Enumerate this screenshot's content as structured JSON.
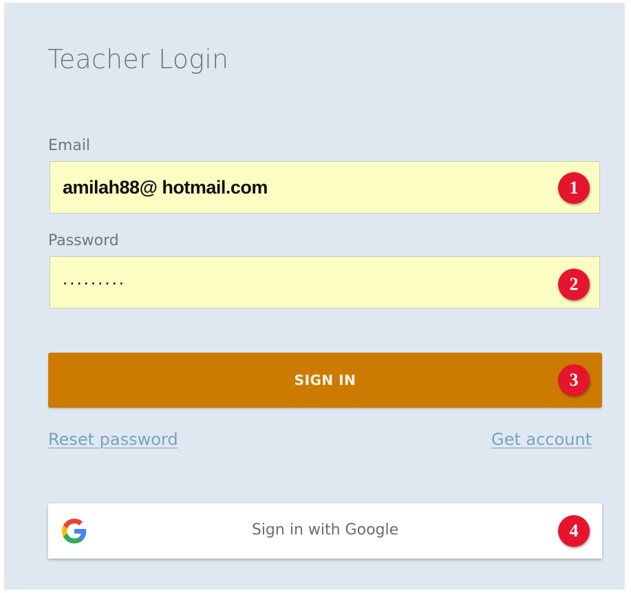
{
  "page": {
    "title": "Teacher Login"
  },
  "email": {
    "label": "Email",
    "value": "amilah88@ hotmail.com"
  },
  "password": {
    "label": "Password",
    "value": "........."
  },
  "buttons": {
    "signin_label": "SIGN IN",
    "google_label": "Sign in with Google"
  },
  "links": {
    "reset": "Reset password",
    "get_account": "Get account"
  },
  "badges": [
    "1",
    "2",
    "3",
    "4"
  ],
  "colors": {
    "background": "#dfe8f1",
    "input_fill": "#fbfdc2",
    "signin_button": "#cd7b00",
    "link": "#79a2c2",
    "badge": "#e5152d"
  },
  "icons": {
    "google": "google-g-logo"
  }
}
